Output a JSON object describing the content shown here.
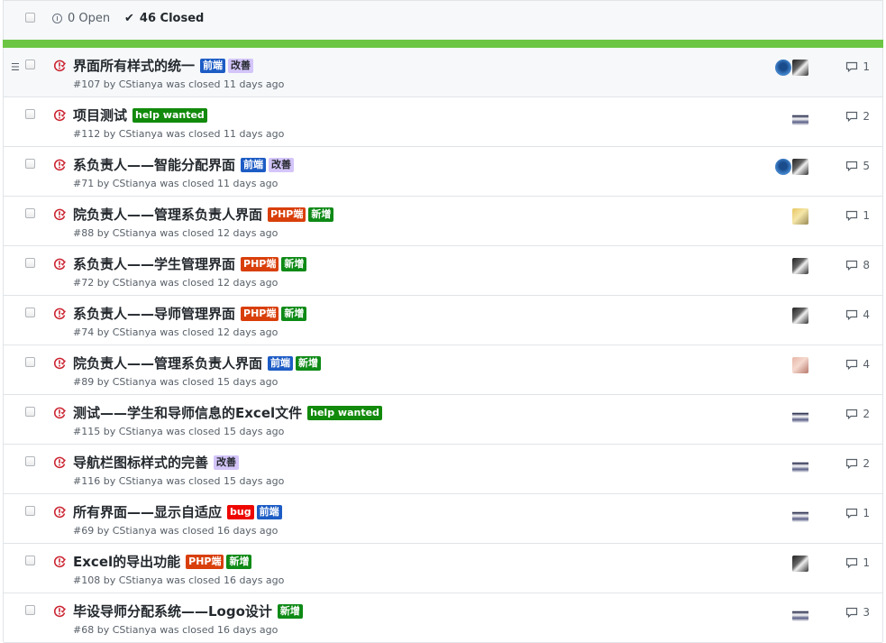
{
  "header": {
    "open_count": "0 Open",
    "closed_count": "46 Closed"
  },
  "colors": {
    "progress": "#6cc644",
    "closed_icon": "#cb2431"
  },
  "label_styles": {
    "前端": {
      "bg": "#1d5cc5",
      "fg": "#ffffff"
    },
    "改善": {
      "bg": "#d4c5f9",
      "fg": "#24292e"
    },
    "help wanted": {
      "bg": "#128a0c",
      "fg": "#ffffff"
    },
    "PHP端": {
      "bg": "#d93f0b",
      "fg": "#ffffff"
    },
    "新增": {
      "bg": "#0e8a16",
      "fg": "#ffffff"
    },
    "bug": {
      "bg": "#ee0701",
      "fg": "#ffffff"
    }
  },
  "issues": [
    {
      "title": "界面所有样式的统一",
      "labels": [
        "前端",
        "改善"
      ],
      "meta": "#107 by CStianya was closed 11 days ago",
      "comments": "1",
      "avatars": [
        "avatar-blue",
        "avatar-dark"
      ]
    },
    {
      "title": "项目测试",
      "labels": [
        "help wanted"
      ],
      "meta": "#112 by CStianya was closed 11 days ago",
      "comments": "2",
      "avatars": [
        "avatar-anime"
      ]
    },
    {
      "title": "系负责人——智能分配界面",
      "labels": [
        "前端",
        "改善"
      ],
      "meta": "#71 by CStianya was closed 11 days ago",
      "comments": "5",
      "avatars": [
        "avatar-blue",
        "avatar-dark"
      ]
    },
    {
      "title": "院负责人——管理系负责人界面",
      "labels": [
        "PHP端",
        "新增"
      ],
      "meta": "#88 by CStianya was closed 12 days ago",
      "comments": "1",
      "avatars": [
        "avatar-yellow"
      ]
    },
    {
      "title": "系负责人——学生管理界面",
      "labels": [
        "PHP端",
        "新增"
      ],
      "meta": "#72 by CStianya was closed 12 days ago",
      "comments": "8",
      "avatars": [
        "avatar-dark"
      ]
    },
    {
      "title": "系负责人——导师管理界面",
      "labels": [
        "PHP端",
        "新增"
      ],
      "meta": "#74 by CStianya was closed 12 days ago",
      "comments": "4",
      "avatars": [
        "avatar-dark"
      ]
    },
    {
      "title": "院负责人——管理系负责人界面",
      "labels": [
        "前端",
        "新增"
      ],
      "meta": "#89 by CStianya was closed 15 days ago",
      "comments": "4",
      "avatars": [
        "avatar-pink"
      ]
    },
    {
      "title": "测试——学生和导师信息的Excel文件",
      "labels": [
        "help wanted"
      ],
      "meta": "#115 by CStianya was closed 15 days ago",
      "comments": "2",
      "avatars": [
        "avatar-anime"
      ]
    },
    {
      "title": "导航栏图标样式的完善",
      "labels": [
        "改善"
      ],
      "meta": "#116 by CStianya was closed 15 days ago",
      "comments": "2",
      "avatars": [
        "avatar-anime"
      ]
    },
    {
      "title": "所有界面——显示自适应",
      "labels": [
        "bug",
        "前端"
      ],
      "meta": "#69 by CStianya was closed 16 days ago",
      "comments": "1",
      "avatars": [
        "avatar-anime"
      ]
    },
    {
      "title": "Excel的导出功能",
      "labels": [
        "PHP端",
        "新增"
      ],
      "meta": "#108 by CStianya was closed 16 days ago",
      "comments": "1",
      "avatars": [
        "avatar-dark"
      ]
    },
    {
      "title": "毕设导师分配系统——Logo设计",
      "labels": [
        "新增"
      ],
      "meta": "#68 by CStianya was closed 16 days ago",
      "comments": "3",
      "avatars": [
        "avatar-anime"
      ]
    }
  ]
}
